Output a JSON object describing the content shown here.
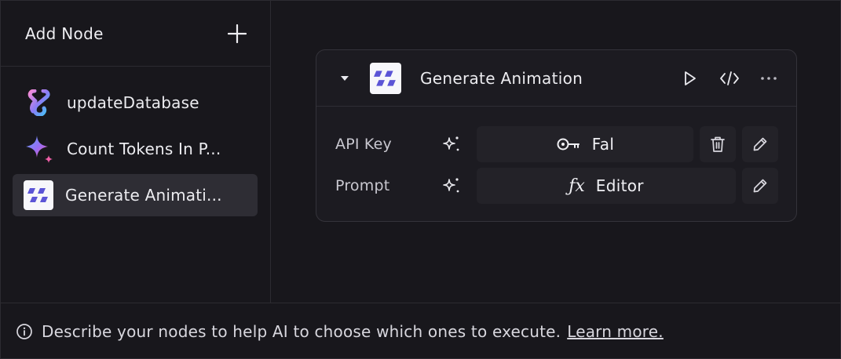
{
  "sidebar": {
    "title": "Add Node",
    "items": [
      {
        "label": "updateDatabase",
        "icon": "database-logo-icon"
      },
      {
        "label": "Count Tokens In P...",
        "icon": "sparkle-gem-icon"
      },
      {
        "label": "Generate Animati...",
        "icon": "fal-logo-icon",
        "active": true
      }
    ]
  },
  "card": {
    "title": "Generate Animation",
    "rows": [
      {
        "label": "API Key",
        "value": "Fal",
        "value_icon": "key-icon"
      },
      {
        "label": "Prompt",
        "value": "Editor",
        "value_icon": "function-icon"
      }
    ]
  },
  "footer": {
    "text": "Describe your nodes to help AI to choose which ones to execute.",
    "link": "Learn more."
  },
  "colors": {
    "background": "#18171c",
    "card": "#1c1b21",
    "button": "#232228",
    "active": "#2e2d34",
    "text": "#ececf0"
  }
}
